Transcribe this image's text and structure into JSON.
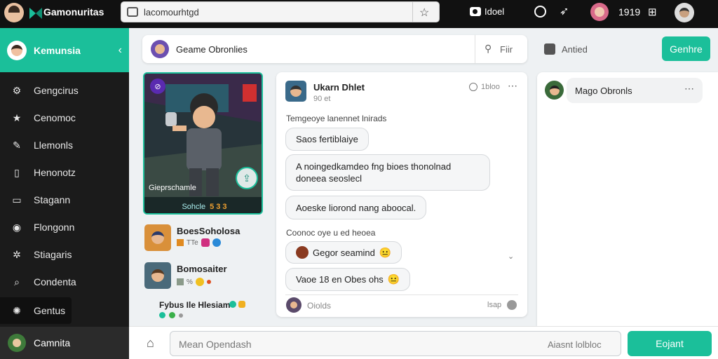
{
  "topbar": {
    "app_title": "Gamonuritas",
    "address": "lacomourhtgd",
    "camera_label": "Idoel",
    "count_label": "1919"
  },
  "sidebar": {
    "user_name": "Kemunsia",
    "items": [
      {
        "label": "Gengcirus",
        "icon": "gear-icon"
      },
      {
        "label": "Cenomoc",
        "icon": "star-icon"
      },
      {
        "label": "Llemonls",
        "icon": "edit-icon"
      },
      {
        "label": "Henonotz",
        "icon": "phone-icon"
      },
      {
        "label": "Stagann",
        "icon": "monitor-icon"
      },
      {
        "label": "Flongonn",
        "icon": "shield-icon"
      },
      {
        "label": "Stiagaris",
        "icon": "cog-icon"
      },
      {
        "label": "Condenta",
        "icon": "search-icon"
      },
      {
        "label": "Gentus",
        "icon": "settings-icon"
      }
    ],
    "bottom_user": "Camnita"
  },
  "header": {
    "title": "Geame Obronlies",
    "filter_label": "Fiir",
    "anted_label": "Antied",
    "genre_button": "Genhre"
  },
  "game_card": {
    "caption": "Gieprschamle",
    "footer": "Sohcle",
    "footer_nums": "5 3 3"
  },
  "friends": [
    {
      "name": "BoesSoholosa",
      "meta": "TTe"
    },
    {
      "name": "Bomosaiter",
      "meta": "%"
    }
  ],
  "activity": {
    "text": "Fybus Ile Hlesiam"
  },
  "chat": {
    "name": "Ukarn Dhlet",
    "sub": "90 et",
    "time": "1bloo",
    "section1": "Temgeoye lanennet lnirads",
    "msg1": "Saos fertiblaiye",
    "msg2": "A noingedkamdeo fng bioes thonolnad doneea seoslecl",
    "msg3": "Aoeske liorond nang aboocal.",
    "section2": "Coonoc oye u ed heoea",
    "msg4": "Gegor seamind",
    "msg5": "Vaoe 18 en Obes ohs",
    "footer_user": "Oiolds",
    "footer_right": "lsap"
  },
  "right_panel": {
    "title": "Mago Obronls"
  },
  "composer": {
    "placeholder": "Mean Opendash",
    "action": "Aiasnt lolbloc",
    "send": "Eojant"
  },
  "colors": {
    "accent": "#1bbf9a",
    "sidebar_bg": "#1b1b1b",
    "topbar_bg": "#111111"
  }
}
